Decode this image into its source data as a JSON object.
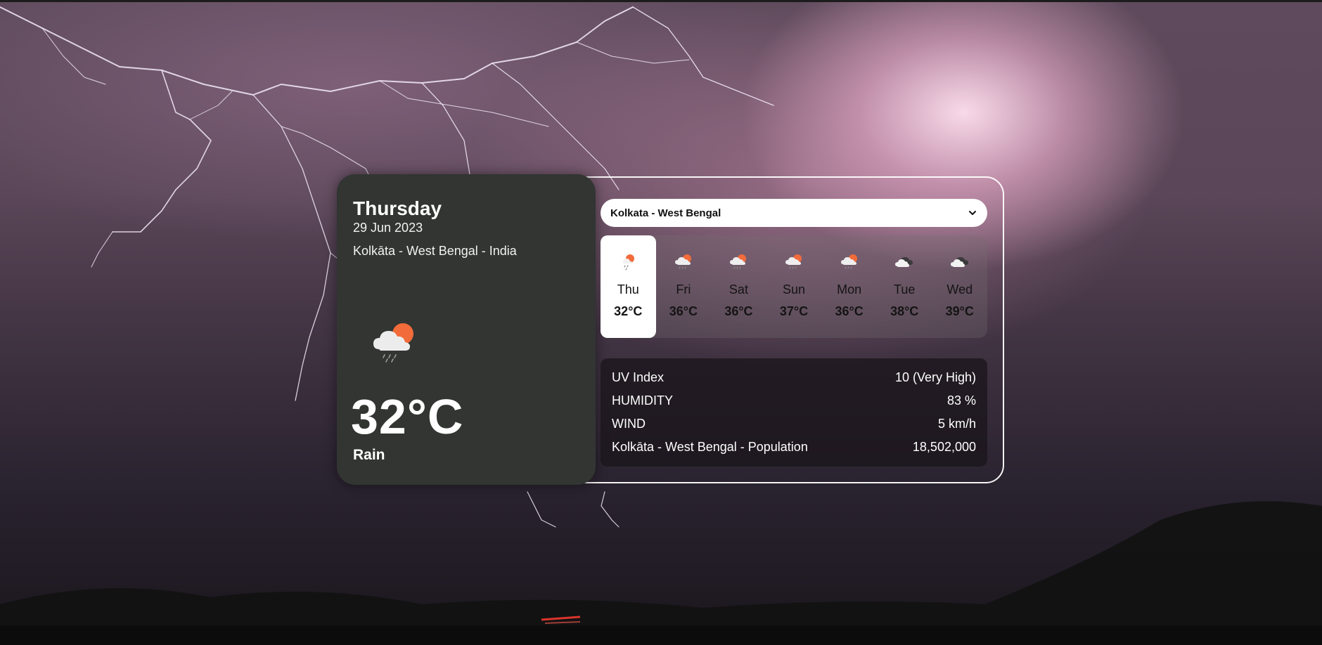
{
  "current": {
    "day": "Thursday",
    "date": "29 Jun 2023",
    "location": "Kolkāta - West Bengal - India",
    "temperature": "32°C",
    "condition": "Rain",
    "icon": "cloud-sun-rain-icon"
  },
  "city_select": {
    "selected": "Kolkata - West Bengal"
  },
  "forecast": [
    {
      "day": "Thu",
      "temp": "32°C",
      "icon": "sun-rain-icon",
      "active": true
    },
    {
      "day": "Fri",
      "temp": "36°C",
      "icon": "cloud-sun-rain-icon",
      "active": false
    },
    {
      "day": "Sat",
      "temp": "36°C",
      "icon": "cloud-sun-rain-icon",
      "active": false
    },
    {
      "day": "Sun",
      "temp": "37°C",
      "icon": "cloud-sun-rain-icon",
      "active": false
    },
    {
      "day": "Mon",
      "temp": "36°C",
      "icon": "cloud-sun-rain-icon",
      "active": false
    },
    {
      "day": "Tue",
      "temp": "38°C",
      "icon": "cloudy-icon",
      "active": false
    },
    {
      "day": "Wed",
      "temp": "39°C",
      "icon": "cloudy-icon",
      "active": false
    }
  ],
  "details": {
    "uv": {
      "label": "UV Index",
      "value": "10 (Very High)"
    },
    "humidity": {
      "label": "HUMIDITY",
      "value": "83 %"
    },
    "wind": {
      "label": "WIND",
      "value": "5 km/h"
    },
    "population": {
      "label": "Kolkāta - West Bengal - Population",
      "value": "18,502,000"
    }
  },
  "colors": {
    "panel": "#323532",
    "accent_sun": "#f26b3a",
    "cloud": "#e9e9e9",
    "dark_cloud": "#3a3a3a"
  }
}
